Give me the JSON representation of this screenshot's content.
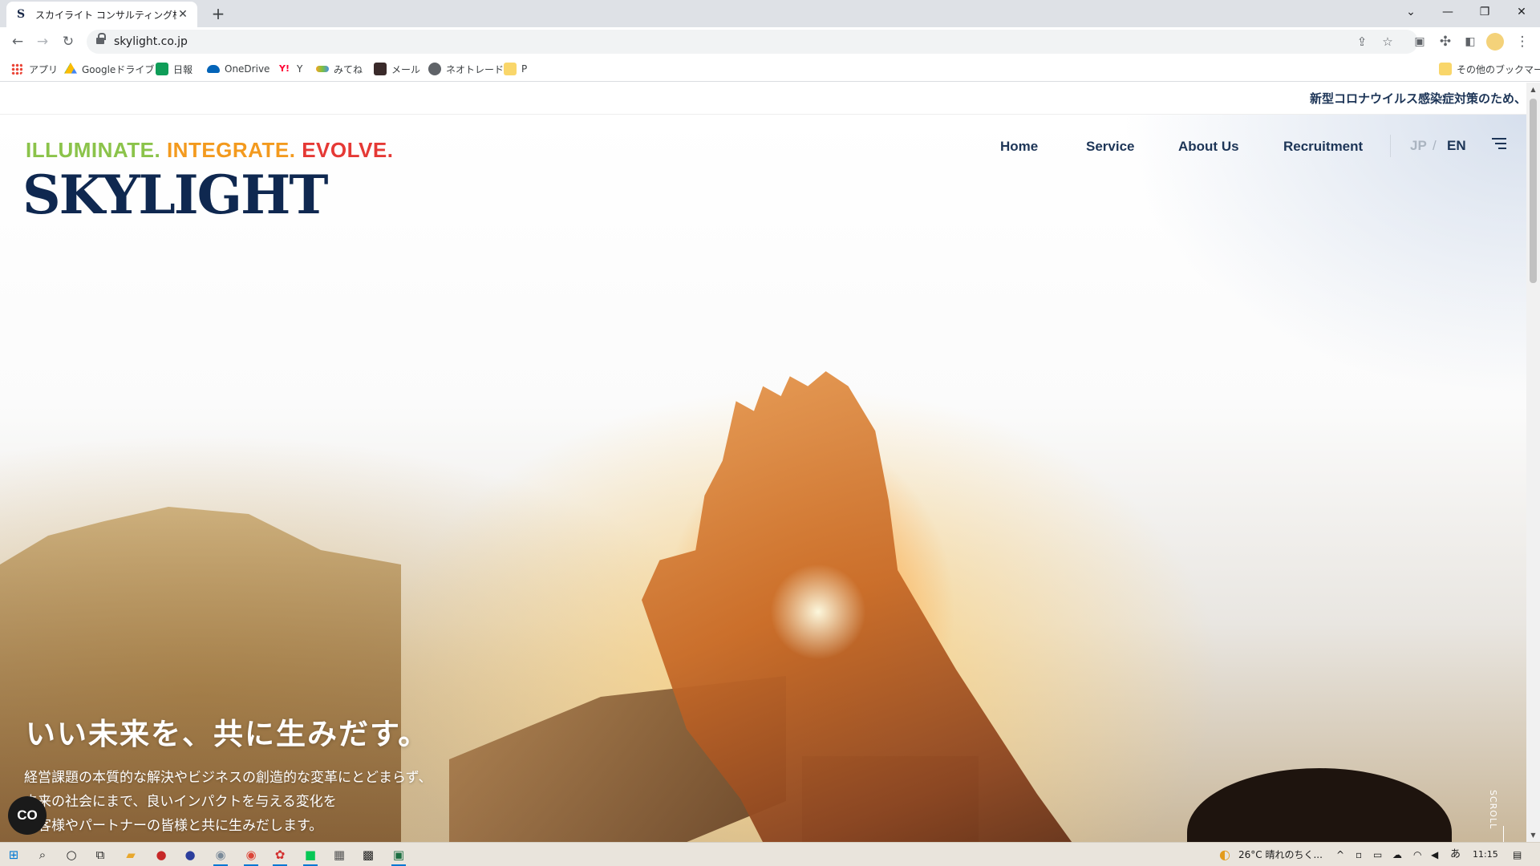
{
  "browser": {
    "tab_title": "スカイライト コンサルティング株式会社",
    "tab_favicon_letter": "S",
    "url": "skylight.co.jp"
  },
  "bookmarks": [
    {
      "label": "アプリ",
      "icon": "apps-grid-icon"
    },
    {
      "label": "Googleドライブ",
      "icon": "google-drive-icon"
    },
    {
      "label": "日報",
      "icon": "sheets-icon"
    },
    {
      "label": "OneDrive",
      "icon": "onedrive-icon"
    },
    {
      "label": "Y",
      "icon": "yahoo-icon"
    },
    {
      "label": "みてね",
      "icon": "mitene-icon"
    },
    {
      "label": "メール",
      "icon": "mail-icon"
    },
    {
      "label": "ネオトレード",
      "icon": "globe-icon"
    },
    {
      "label": "P",
      "icon": "folder-icon"
    }
  ],
  "bookmarks_other": "その他のブックマーク",
  "site": {
    "ticker": "新型コロナウイルス感染症対策のため、",
    "tagline": {
      "part1": "ILLUMINATE.",
      "part2": "INTEGRATE.",
      "part3": "EVOLVE."
    },
    "logo": "SKYLIGHT",
    "nav": [
      "Home",
      "Service",
      "About Us",
      "Recruitment"
    ],
    "lang_jp": "JP",
    "lang_en": "EN",
    "lang_sep": "/",
    "headline": "いい未来を、共に生みだす。",
    "lead": [
      "経営課題の本質的な解決やビジネスの創造的な変革にとどまらず、",
      "未来の社会にまで、良いインパクトを与える変化を",
      "お客様やパートナーの皆様と共に生みだします。"
    ],
    "scroll_label": "SCROLL",
    "cookie_button": "CO"
  },
  "taskbar": {
    "weather": "26°C  晴れのちく...",
    "ime": "あ",
    "time": "11:15"
  },
  "colors": {
    "tagline_green": "#8bc34a",
    "tagline_orange": "#f39a1e",
    "tagline_red": "#e53935",
    "navy": "#0f2850"
  }
}
